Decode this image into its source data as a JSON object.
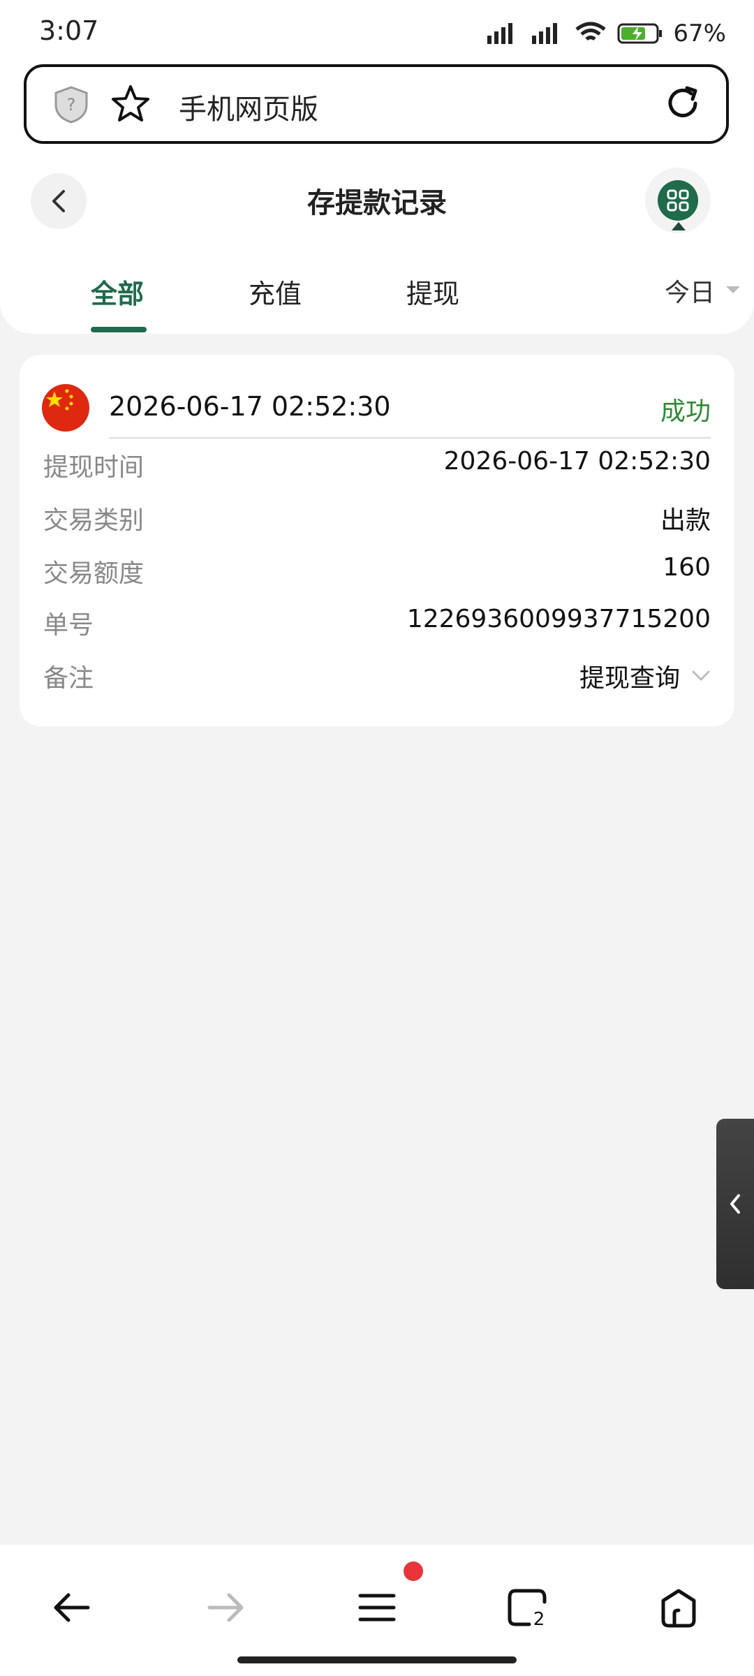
{
  "status_bar": {
    "time": "3:07",
    "battery": "67%"
  },
  "url_bar": {
    "text": "手机网页版"
  },
  "header": {
    "title": "存提款记录",
    "tabs": [
      {
        "label": "全部"
      },
      {
        "label": "充值"
      },
      {
        "label": "提现"
      }
    ],
    "date_filter": "今日"
  },
  "record": {
    "date": "2026-06-17 02:52:30",
    "status": "成功",
    "rows": [
      {
        "label": "提现时间",
        "value": "2026-06-17 02:52:30"
      },
      {
        "label": "交易类别",
        "value": "出款"
      },
      {
        "label": "交易额度",
        "value": "160"
      },
      {
        "label": "单号",
        "value": "1226936009937715200"
      },
      {
        "label": "备注",
        "value": "提现查询"
      }
    ]
  },
  "bottom_nav": {
    "tabs_count": "2"
  },
  "colors": {
    "accent": "#1f6b4c",
    "success": "#2f8a34",
    "badge": "#e8343a"
  }
}
